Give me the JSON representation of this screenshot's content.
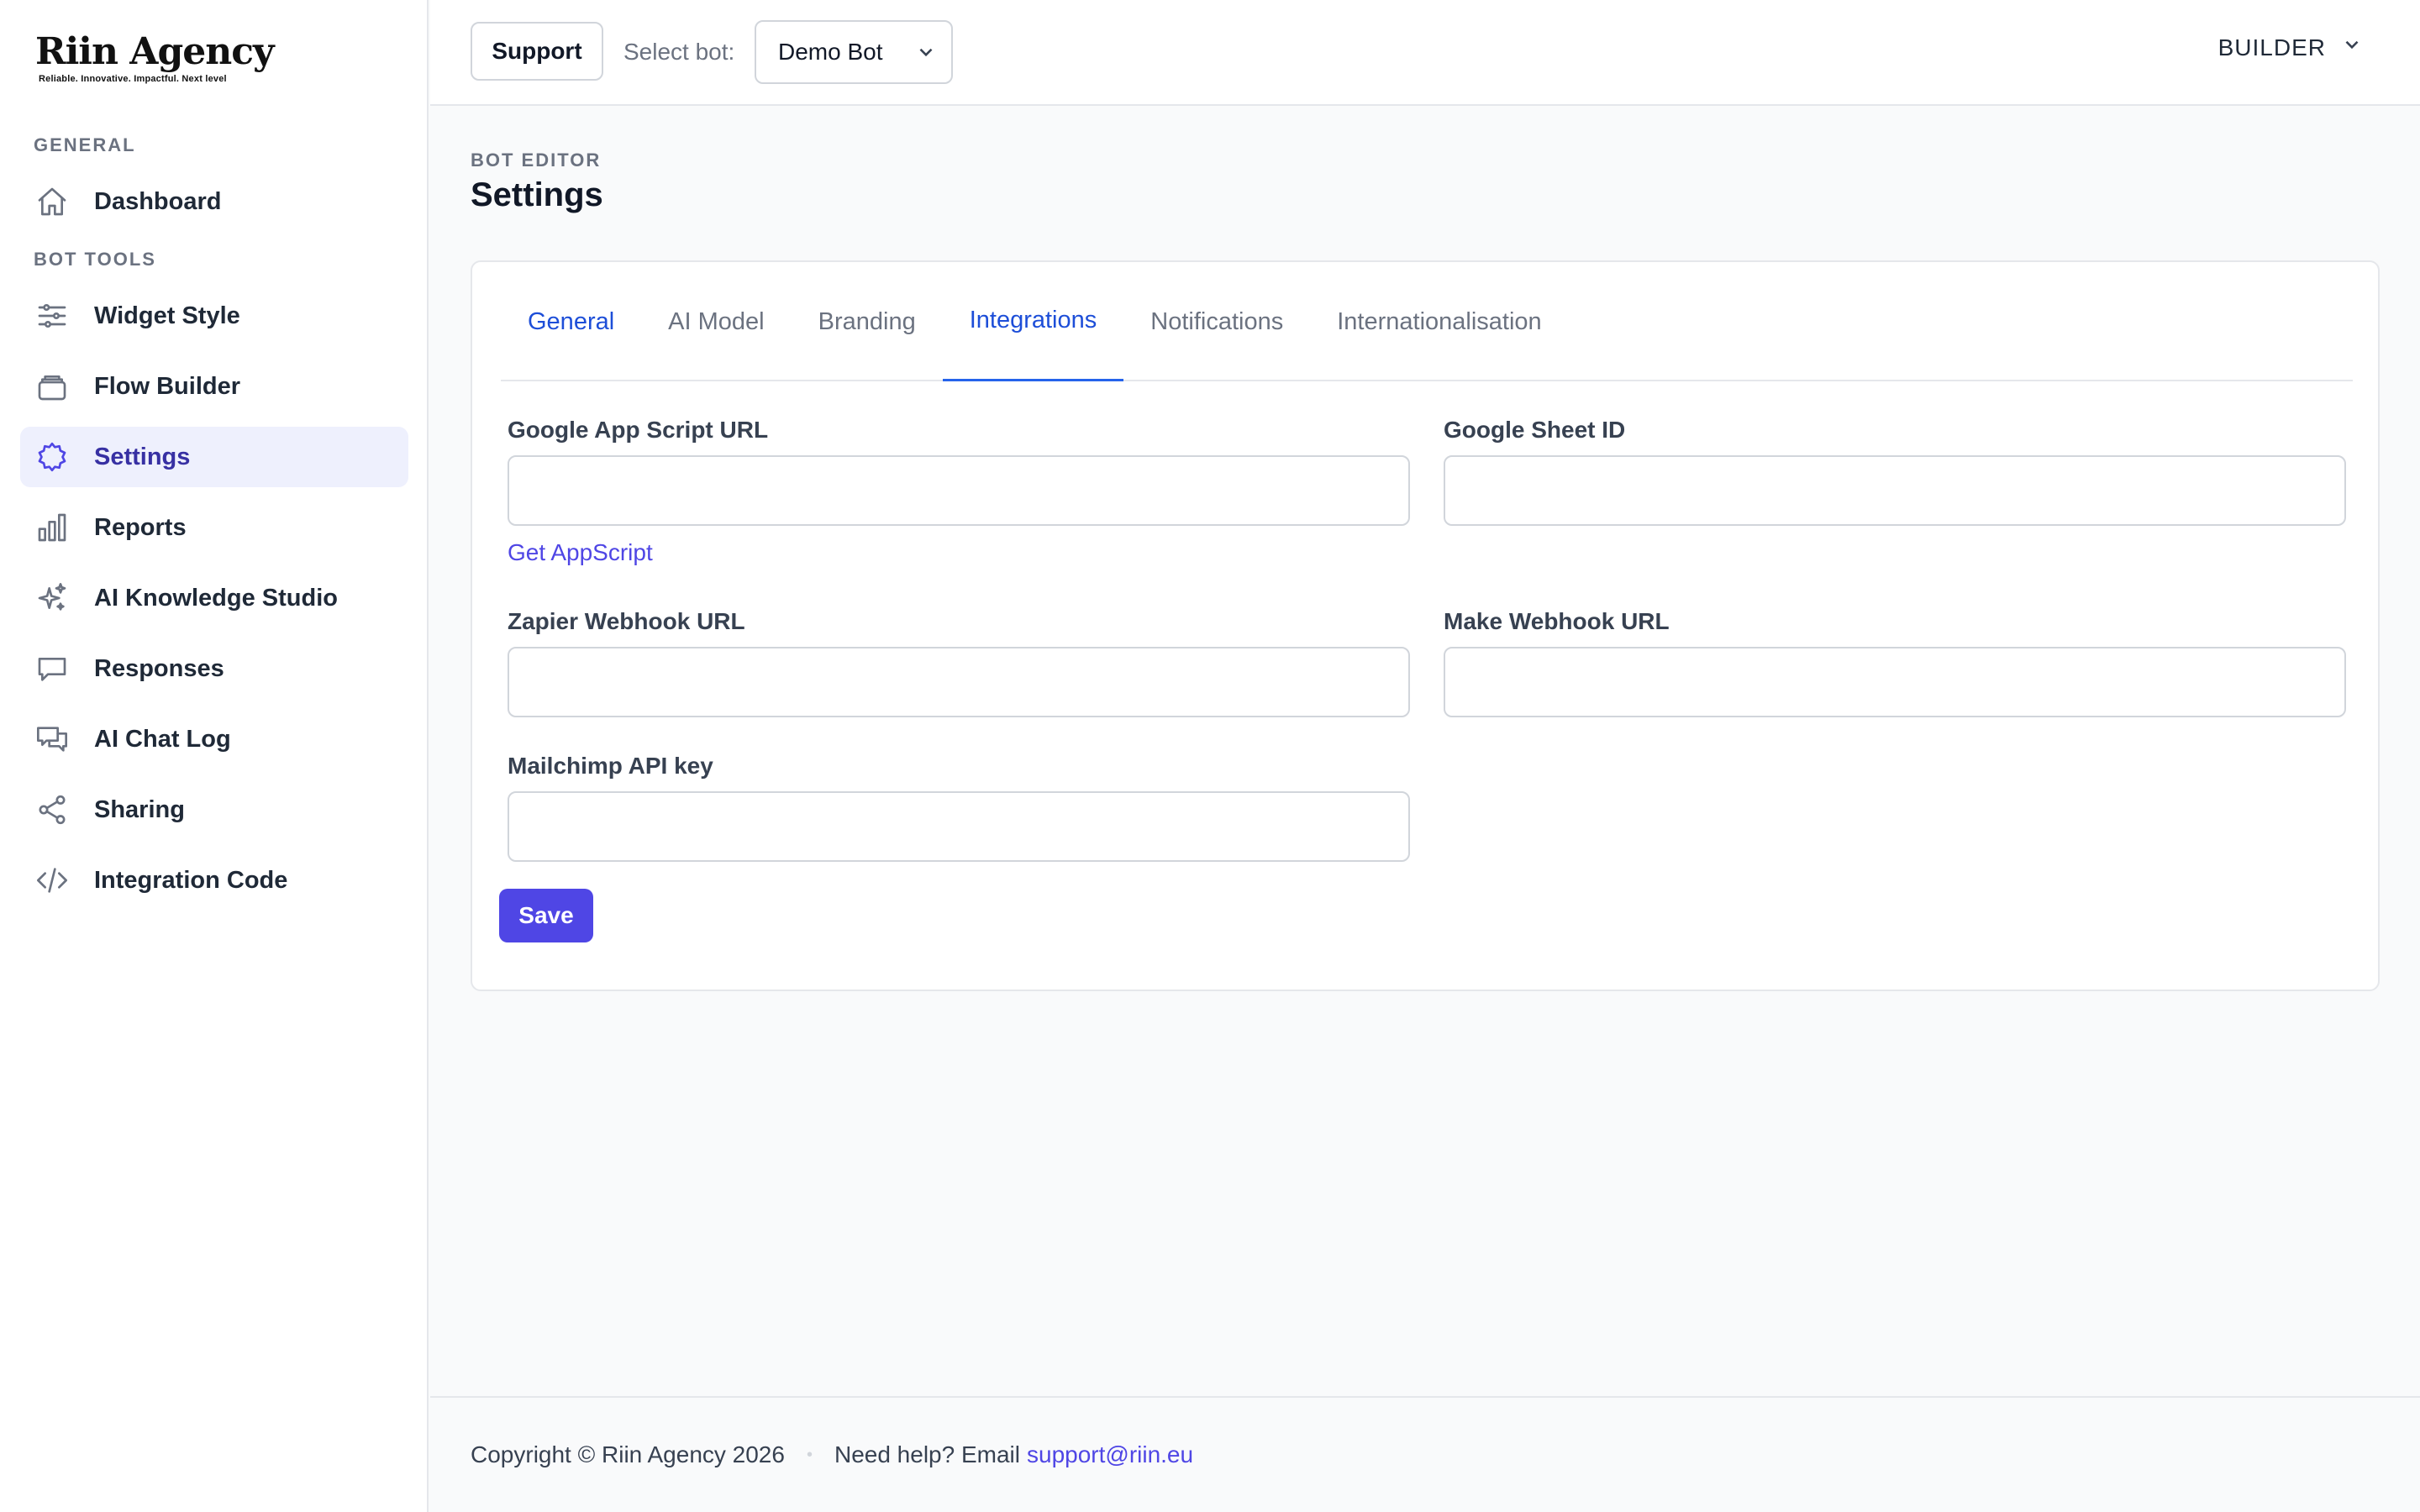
{
  "brand": {
    "name": "Riin Agency",
    "tagline": "Reliable. Innovative. Impactful. Next level"
  },
  "sidebar": {
    "sections": [
      {
        "label": "GENERAL"
      },
      {
        "label": "BOT TOOLS"
      }
    ],
    "items": [
      {
        "label": "Dashboard",
        "icon": "home-icon"
      },
      {
        "label": "Widget Style",
        "icon": "sliders-icon"
      },
      {
        "label": "Flow Builder",
        "icon": "stack-icon"
      },
      {
        "label": "Settings",
        "icon": "gear-icon",
        "active": true
      },
      {
        "label": "Reports",
        "icon": "bar-chart-icon"
      },
      {
        "label": "AI Knowledge Studio",
        "icon": "sparkles-icon"
      },
      {
        "label": "Responses",
        "icon": "chat-bubble-icon"
      },
      {
        "label": "AI Chat Log",
        "icon": "chat-bubbles-icon"
      },
      {
        "label": "Sharing",
        "icon": "share-icon"
      },
      {
        "label": "Integration Code",
        "icon": "code-icon"
      }
    ]
  },
  "topbar": {
    "support_label": "Support",
    "select_bot_label": "Select bot:",
    "selected_bot": "Demo Bot",
    "mode_label": "BUILDER"
  },
  "page": {
    "eyebrow": "BOT EDITOR",
    "title": "Settings"
  },
  "tabs": [
    {
      "label": "General"
    },
    {
      "label": "AI Model"
    },
    {
      "label": "Branding"
    },
    {
      "label": "Integrations",
      "active": true
    },
    {
      "label": "Notifications"
    },
    {
      "label": "Internationalisation"
    }
  ],
  "form": {
    "google_app_script_url": {
      "label": "Google App Script URL",
      "value": ""
    },
    "get_appscript_link": "Get AppScript",
    "google_sheet_id": {
      "label": "Google Sheet ID",
      "value": ""
    },
    "zapier_webhook_url": {
      "label": "Zapier Webhook URL",
      "value": ""
    },
    "make_webhook_url": {
      "label": "Make Webhook URL",
      "value": ""
    },
    "mailchimp_api_key": {
      "label": "Mailchimp API key",
      "value": ""
    },
    "save_label": "Save"
  },
  "footer": {
    "copyright": "Copyright © Riin Agency 2026",
    "help_text": "Need help? Email",
    "email": "support@riin.eu"
  },
  "colors": {
    "accent": "#4f46e5",
    "active_tab": "#2563eb",
    "active_nav_bg": "#eef0fd"
  }
}
